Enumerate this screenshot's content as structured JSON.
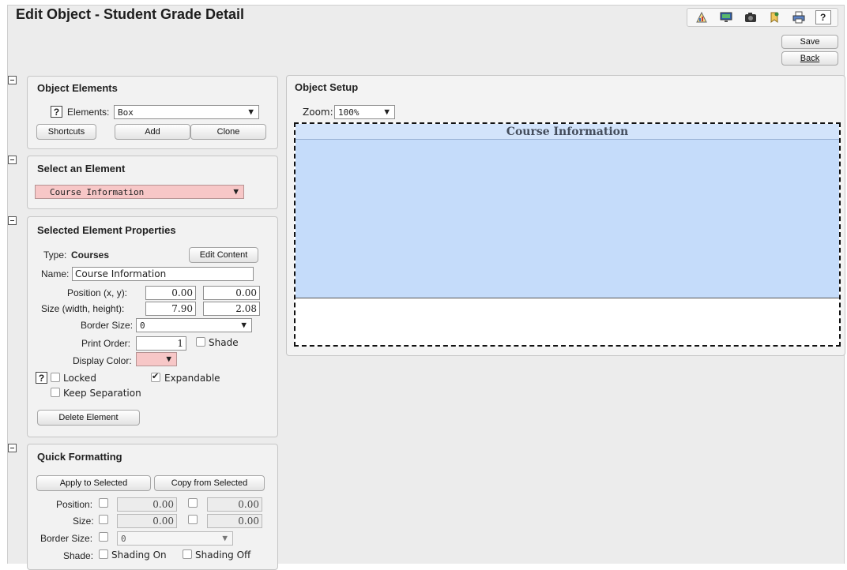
{
  "header": {
    "title": "Edit Object - Student Grade Detail",
    "help_label": "?",
    "save_label": "Save",
    "back_label": "Back"
  },
  "object_elements": {
    "title": "Object Elements",
    "help_label": "?",
    "elements_label": "Elements:",
    "elements_value": "Box",
    "shortcuts_label": "Shortcuts",
    "add_label": "Add",
    "clone_label": "Clone"
  },
  "select_element": {
    "title": "Select an Element",
    "value": "Course Information"
  },
  "properties": {
    "title": "Selected Element Properties",
    "type_label": "Type:",
    "type_value": "Courses",
    "edit_content_label": "Edit Content",
    "name_label": "Name:",
    "name_value": "Course Information",
    "position_label": "Position (x, y):",
    "position_x": "0.00",
    "position_y": "0.00",
    "size_label": "Size (width, height):",
    "size_w": "7.90",
    "size_h": "2.08",
    "border_label": "Border Size:",
    "border_value": "0",
    "print_order_label": "Print Order:",
    "print_order_value": "1",
    "shade_label": "Shade",
    "display_color_label": "Display Color:",
    "display_color": "#f7c7c7",
    "help_label": "?",
    "locked_label": "Locked",
    "expandable_label": "Expandable",
    "keep_separation_label": "Keep Separation",
    "delete_label": "Delete Element"
  },
  "quick_formatting": {
    "title": "Quick Formatting",
    "apply_label": "Apply to Selected",
    "copy_label": "Copy from Selected",
    "position_label": "Position:",
    "position_x": "0.00",
    "position_y": "0.00",
    "size_label": "Size:",
    "size_w": "0.00",
    "size_h": "0.00",
    "border_label": "Border Size:",
    "border_value": "0",
    "shade_label": "Shade:",
    "shading_on_label": "Shading On",
    "shading_off_label": "Shading Off"
  },
  "object_setup": {
    "title": "Object Setup",
    "zoom_label": "Zoom:",
    "zoom_value": "100%",
    "element_title": "Course Information",
    "element_color": "#c5dcfa"
  },
  "icons": [
    "report-icon",
    "monitor-icon",
    "camera-icon",
    "bookmark-icon",
    "print-icon",
    "help-icon"
  ]
}
